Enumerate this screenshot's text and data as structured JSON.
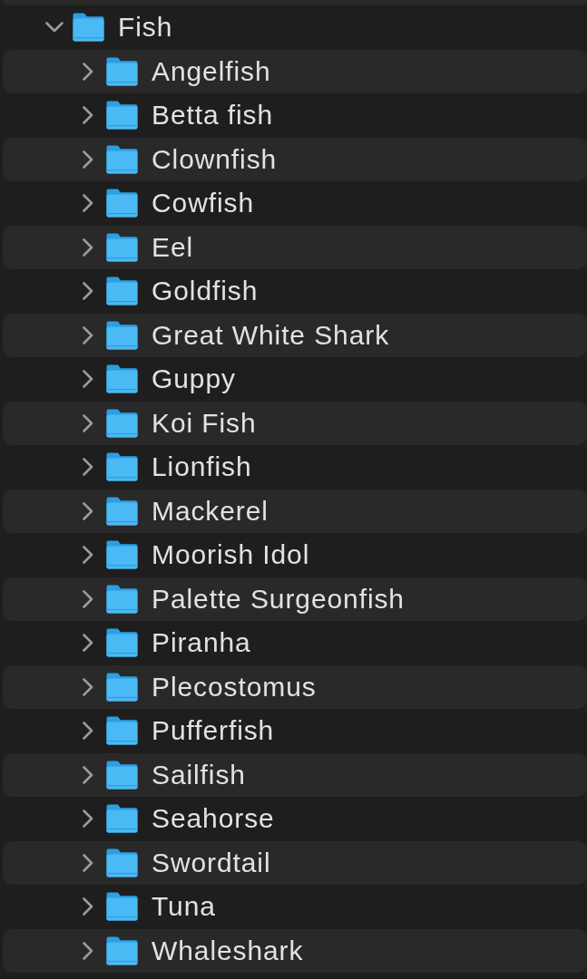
{
  "folder": {
    "name": "Fish",
    "expanded": true,
    "children": [
      {
        "name": "Angelfish",
        "expanded": false
      },
      {
        "name": "Betta fish",
        "expanded": false
      },
      {
        "name": "Clownfish",
        "expanded": false
      },
      {
        "name": "Cowfish",
        "expanded": false
      },
      {
        "name": "Eel",
        "expanded": false
      },
      {
        "name": "Goldfish",
        "expanded": false
      },
      {
        "name": "Great White Shark",
        "expanded": false
      },
      {
        "name": "Guppy",
        "expanded": false
      },
      {
        "name": "Koi Fish",
        "expanded": false
      },
      {
        "name": "Lionfish",
        "expanded": false
      },
      {
        "name": "Mackerel",
        "expanded": false
      },
      {
        "name": "Moorish Idol",
        "expanded": false
      },
      {
        "name": "Palette Surgeonfish",
        "expanded": false
      },
      {
        "name": "Piranha",
        "expanded": false
      },
      {
        "name": "Plecostomus",
        "expanded": false
      },
      {
        "name": "Pufferfish",
        "expanded": false
      },
      {
        "name": "Sailfish",
        "expanded": false
      },
      {
        "name": "Seahorse",
        "expanded": false
      },
      {
        "name": "Swordtail",
        "expanded": false
      },
      {
        "name": "Tuna",
        "expanded": false
      },
      {
        "name": "Whaleshark",
        "expanded": false
      }
    ]
  }
}
